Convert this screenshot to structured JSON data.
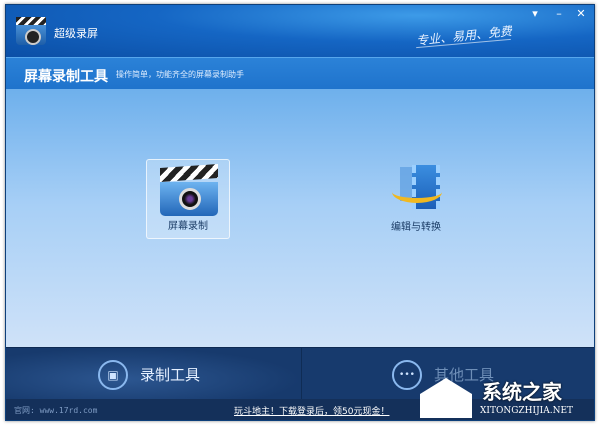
{
  "app": {
    "title": "超级录屏",
    "slogan": "专业、易用、免费"
  },
  "window_controls": {
    "menu": "▾",
    "minimize": "–",
    "close": "✕"
  },
  "header": {
    "title": "屏幕录制工具",
    "description": "操作简单，功能齐全的屏幕录制助手"
  },
  "tools": [
    {
      "label": "屏幕录制",
      "icon": "clapperboard-camera-icon",
      "selected": true
    },
    {
      "label": "编辑与转换",
      "icon": "film-convert-icon",
      "selected": false
    }
  ],
  "tabs": [
    {
      "label": "录制工具",
      "icon": "film-icon",
      "active": true
    },
    {
      "label": "其他工具",
      "icon": "more-icon",
      "glyph": "•••",
      "active": false
    }
  ],
  "footer": {
    "site": "官网: www.17rd.com",
    "promo": "玩斗地主！下载登录后，领50元现金！"
  },
  "watermark": {
    "text": "系统之家",
    "url": "XITONGZHIJIA.NET"
  }
}
